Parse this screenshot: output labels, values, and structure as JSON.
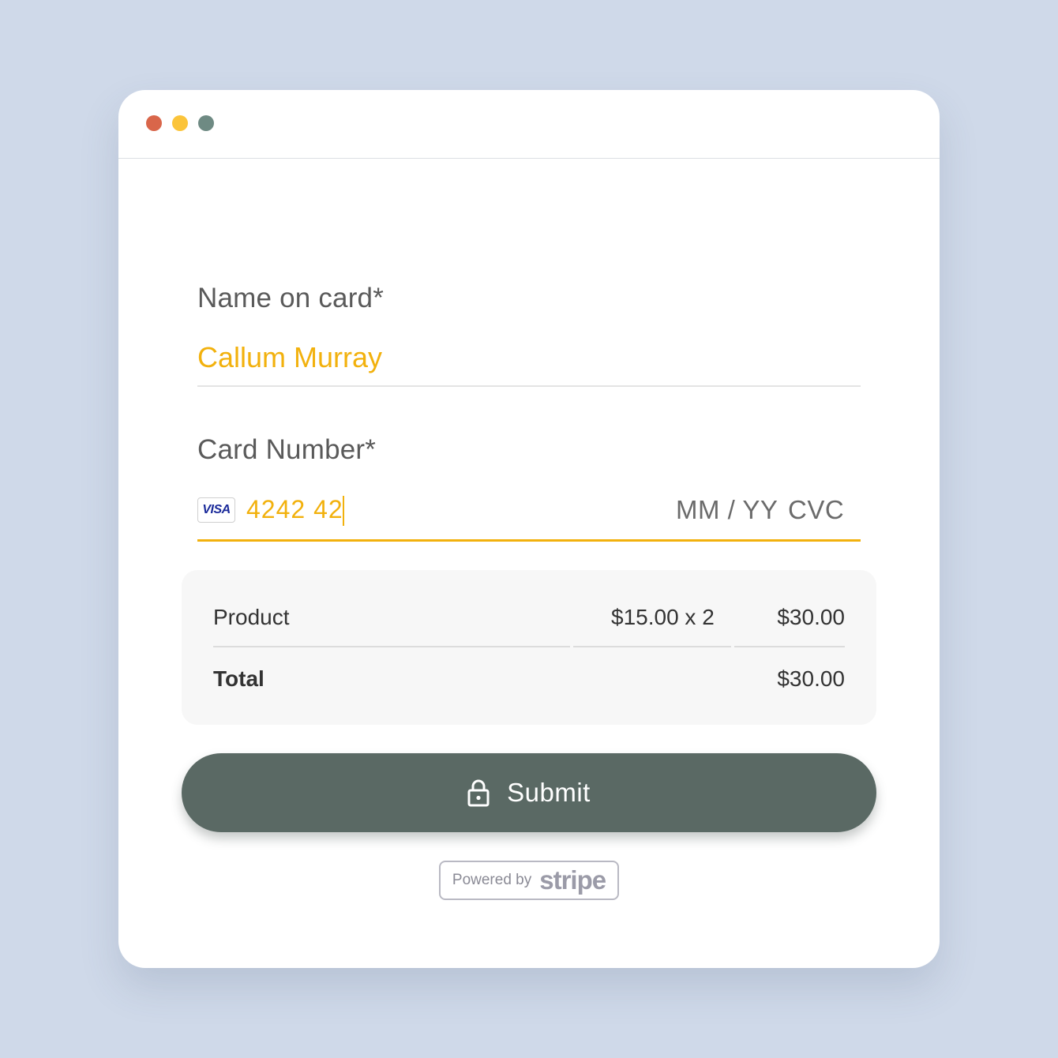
{
  "form": {
    "name_label": "Name on card*",
    "name_value": "Callum Murray",
    "card_label": "Card Number*",
    "card_brand_icon": "visa-icon",
    "card_brand_text": "VISA",
    "card_value": "4242 42",
    "expiry_placeholder": "MM / YY",
    "cvc_placeholder": "CVC"
  },
  "summary": {
    "product_label": "Product",
    "unit_price": "$15.00 x 2",
    "line_total": "$30.00",
    "total_label": "Total",
    "total_value": "$30.00"
  },
  "submit": {
    "icon": "lock-icon",
    "label": "Submit"
  },
  "badge": {
    "powered_by": "Powered by",
    "brand": "stripe"
  },
  "colors": {
    "accent": "#f2b10d",
    "button": "#5a6964",
    "background": "#cfd9e9",
    "dot_red": "#d9664a",
    "dot_yellow": "#fbc43a",
    "dot_green": "#6e8a83"
  }
}
